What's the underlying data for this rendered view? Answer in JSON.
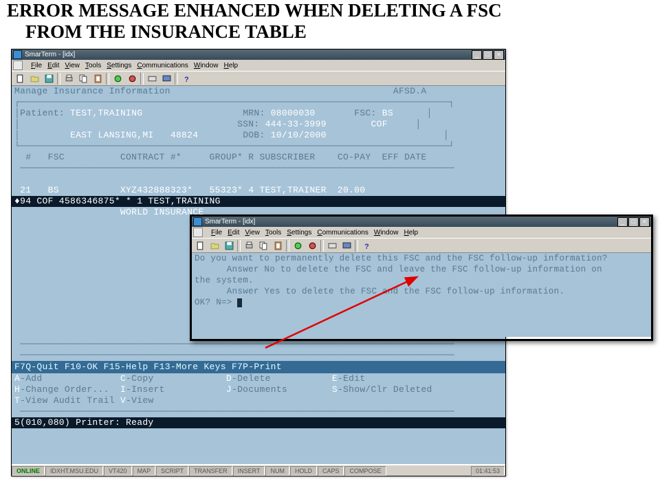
{
  "title_line1": "ERROR MESSAGE ENHANCED WHEN DELETING A FSC",
  "title_line2": "FROM THE INSURANCE TABLE",
  "main": {
    "wintitle": "SmarTerm - [idx]",
    "menu": [
      "File",
      "Edit",
      "View",
      "Tools",
      "Settings",
      "Communications",
      "Window",
      "Help"
    ],
    "screen_title": "Manage Insurance Information",
    "screen_code": "AFSD.A",
    "labels": {
      "patient": "Patient:",
      "mrn": "MRN:",
      "fsc": "FSC:",
      "ssn": "SSN:",
      "dob": "DOB:"
    },
    "patient": {
      "name": "TEST,TRAINING",
      "mrn": "08000030",
      "fsc1": "BS",
      "ssn": "444-33-3999",
      "fsc2": "COF",
      "city": "EAST LANSING,MI",
      "zip": "48824",
      "dob": "10/10/2000"
    },
    "cols": "  #   FSC          CONTRACT #*     GROUP* R SUBSCRIBER    CO-PAY  EFF DATE",
    "rows": [
      " 21   BS           XYZ432888323*   55323* 4 TEST,TRAINER  20.00           ",
      "♦94   COF          4586346875*        *   1 TEST,TRAINING                 "
    ],
    "rowextra": "                   WORLD INSURANCE",
    "fkeys": "  F7Q-Quit   F10-OK   F15-Help   F13-More Keys F7P-Print                   ",
    "cmds": {
      "A": "A-Add",
      "C": "C-Copy",
      "D": "D-Delete",
      "E": "E-Edit",
      "H": "H-Change Order...",
      "I": "I-Insert",
      "J": "J-Documents",
      "S": "S-Show/Clr Deleted",
      "T": "T-View Audit Trail",
      "V": "V-View"
    },
    "bottom_status": "5(010,080)                           Printer:  Ready",
    "sb": {
      "online": "ONLINE",
      "host": "IDXHT.MSU.EDU",
      "emul": "VT420",
      "map": "MAP",
      "script": "SCRIPT",
      "tx": "TRANSFER",
      "ins": "INSERT",
      "num": "NUM",
      "hold": "HOLD",
      "caps": "CAPS",
      "comp": "COMPOSE",
      "time": "01:41:53"
    }
  },
  "dialog": {
    "wintitle": "SmarTerm - [idx]",
    "menu": [
      "File",
      "Edit",
      "View",
      "Tools",
      "Settings",
      "Communications",
      "Window",
      "Help"
    ],
    "l1": "Do you want to permanently delete this FSC and the FSC follow-up information?",
    "l2": "      Answer No to delete the FSC and leave the FSC follow-up information on",
    "l3": "the system.",
    "l4": "      Answer Yes to delete the FSC and the FSC follow-up information.",
    "l5": "OK? N=> "
  }
}
